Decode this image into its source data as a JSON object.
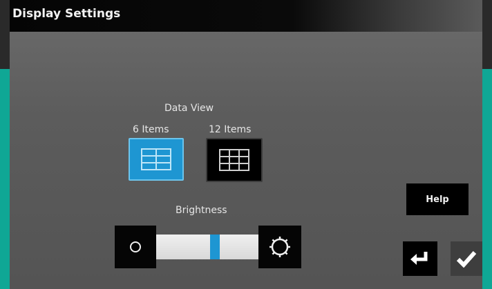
{
  "title": "Display Settings",
  "data_view": {
    "label": "Data View",
    "options": [
      {
        "label": "6 Items",
        "selected": true
      },
      {
        "label": "12 Items",
        "selected": false
      }
    ]
  },
  "brightness": {
    "label": "Brightness",
    "level": 0.58,
    "decrease_icon": "brightness-low-icon",
    "increase_icon": "brightness-high-icon"
  },
  "buttons": {
    "help": "Help",
    "back_icon": "return-arrow-icon",
    "accept_icon": "checkmark-icon"
  },
  "colors": {
    "accent": "#1e96d2",
    "frame": "#0fa795",
    "title_bar": "#050505"
  }
}
